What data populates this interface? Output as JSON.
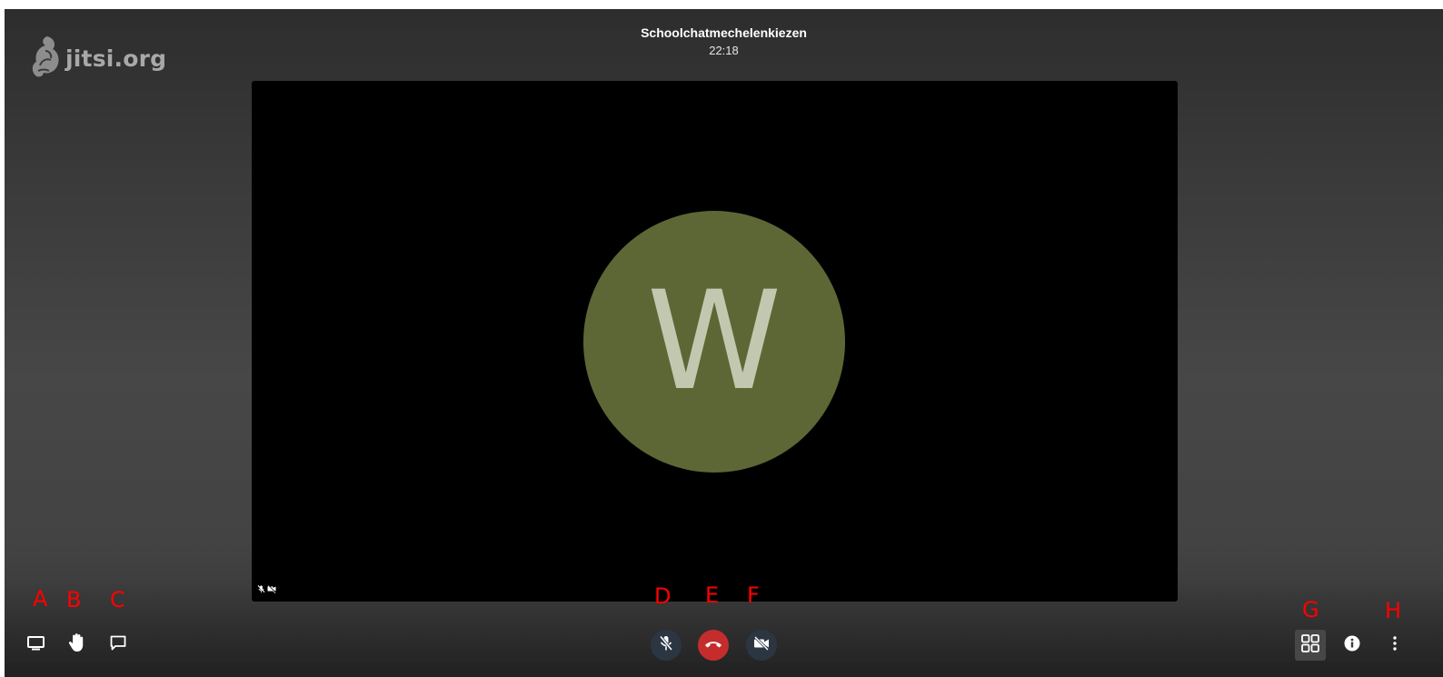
{
  "branding": {
    "logo_text": "jitsi.org"
  },
  "header": {
    "meeting_title": "Schoolchatmechelenkiezen",
    "elapsed_time": "22:18"
  },
  "participant": {
    "avatar_initial": "W",
    "avatar_color": "#5d6735",
    "audio_muted": true,
    "video_muted": true
  },
  "toolbar": {
    "left": [
      {
        "icon": "screen-share-icon",
        "marker": "A"
      },
      {
        "icon": "raise-hand-icon",
        "marker": "B"
      },
      {
        "icon": "chat-icon",
        "marker": "C"
      }
    ],
    "center": [
      {
        "icon": "microphone-muted-icon",
        "marker": "D"
      },
      {
        "icon": "hangup-icon",
        "marker": "E",
        "color": "#c52d2d"
      },
      {
        "icon": "camera-off-icon",
        "marker": "F"
      }
    ],
    "right": [
      {
        "icon": "tile-view-icon",
        "marker": "G"
      },
      {
        "icon": "info-icon",
        "marker": ""
      },
      {
        "icon": "more-options-icon",
        "marker": "H"
      }
    ]
  },
  "annotation_color": "#ff0000"
}
